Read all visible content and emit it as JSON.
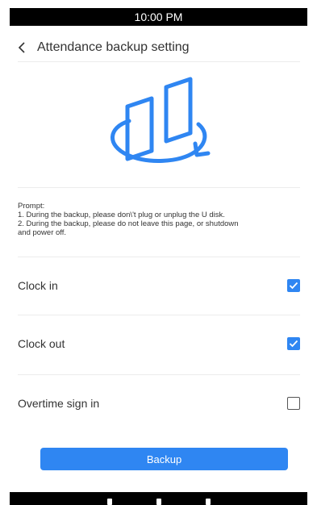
{
  "status_bar": {
    "time": "10:00 PM"
  },
  "header": {
    "back_icon": "chevron-left-icon",
    "title": "Attendance backup setting"
  },
  "hero": {
    "icon": "backup-sync-icon",
    "accent_color": "#2f86f2"
  },
  "prompt": {
    "lines": [
      "Prompt:",
      "1. During the backup, please don\\'t plug or unplug the U disk.",
      "2. During the backup, please do not leave this page, or  shutdown",
      " and power off."
    ]
  },
  "options": [
    {
      "label": "Clock in",
      "checked": true
    },
    {
      "label": "Clock out",
      "checked": true
    },
    {
      "label": "Overtime sign in",
      "checked": false
    }
  ],
  "backup_button": {
    "label": "Backup",
    "color": "#2f86f2"
  },
  "nav_bar": {
    "icons": [
      "back-icon",
      "home-icon",
      "recents-icon"
    ]
  }
}
